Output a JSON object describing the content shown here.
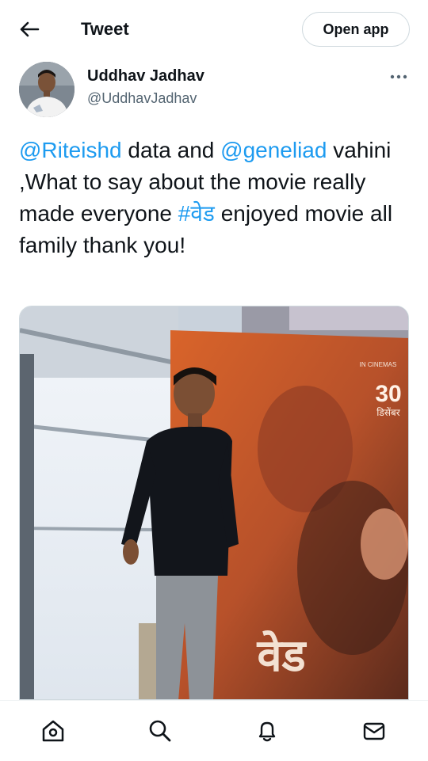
{
  "header": {
    "back_icon": "arrow-left-icon",
    "title": "Tweet",
    "open_app_label": "Open app"
  },
  "author": {
    "name": "Uddhav Jadhav",
    "handle": "@UddhavJadhav",
    "more_icon": "more-horizontal-icon"
  },
  "tweet": {
    "mention1": "@Riteishd",
    "text1": " data and ",
    "mention2": "@geneliad",
    "text2": " vahini ,What to say about the movie really made everyone ",
    "hashtag": "#वेड",
    "text3": " enjoyed movie all family thank you!"
  },
  "media": {
    "poster_small": "IN CINEMAS",
    "poster_date": "30",
    "poster_month": "डिसेंबर",
    "poster_title": "वेड"
  },
  "bottom_nav": [
    {
      "icon": "home-icon"
    },
    {
      "icon": "search-icon"
    },
    {
      "icon": "notifications-bell-icon"
    },
    {
      "icon": "messages-envelope-icon"
    }
  ],
  "colors": {
    "link": "#1d9bf0",
    "text": "#0f1419",
    "secondary": "#536471",
    "border": "#cfd9de"
  }
}
